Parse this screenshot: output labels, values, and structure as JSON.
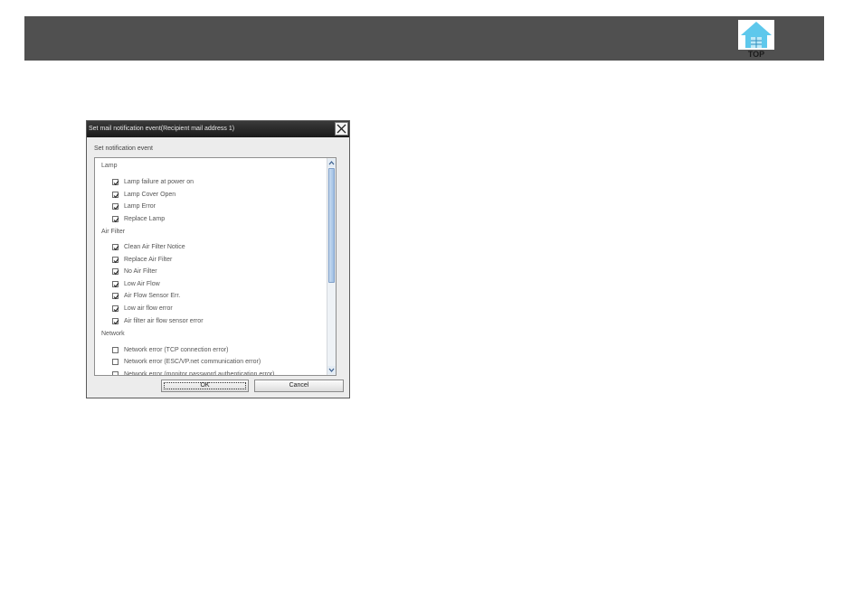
{
  "top_button": {
    "label": "TOP",
    "icon": "top-home-icon"
  },
  "dialog": {
    "title": "Set mail notification event(Recipient mail address 1)",
    "section_caption": "Set notification event",
    "categories": [
      {
        "label": "Lamp",
        "items": [
          {
            "label": "Lamp failure at power on",
            "checked": true
          },
          {
            "label": "Lamp Cover Open",
            "checked": true
          },
          {
            "label": "Lamp Error",
            "checked": true
          },
          {
            "label": "Replace Lamp",
            "checked": true
          }
        ]
      },
      {
        "label": "Air Filter",
        "items": [
          {
            "label": "Clean Air Filter Notice",
            "checked": true
          },
          {
            "label": "Replace Air Filter",
            "checked": true
          },
          {
            "label": "No Air Filter",
            "checked": true
          },
          {
            "label": "Low Air Flow",
            "checked": true
          },
          {
            "label": "Air Flow Sensor Err.",
            "checked": true
          },
          {
            "label": "Low air flow error",
            "checked": true
          },
          {
            "label": "Air filter air flow sensor error",
            "checked": true
          }
        ]
      },
      {
        "label": "Network",
        "items": [
          {
            "label": "Network error (TCP connection error)",
            "checked": false
          },
          {
            "label": "Network error (ESC/VP.net communication error)",
            "checked": false
          },
          {
            "label": "Network error (monitor password authentication error)",
            "checked": false
          }
        ]
      }
    ],
    "ok_label": "OK",
    "cancel_label": "Cancel"
  }
}
